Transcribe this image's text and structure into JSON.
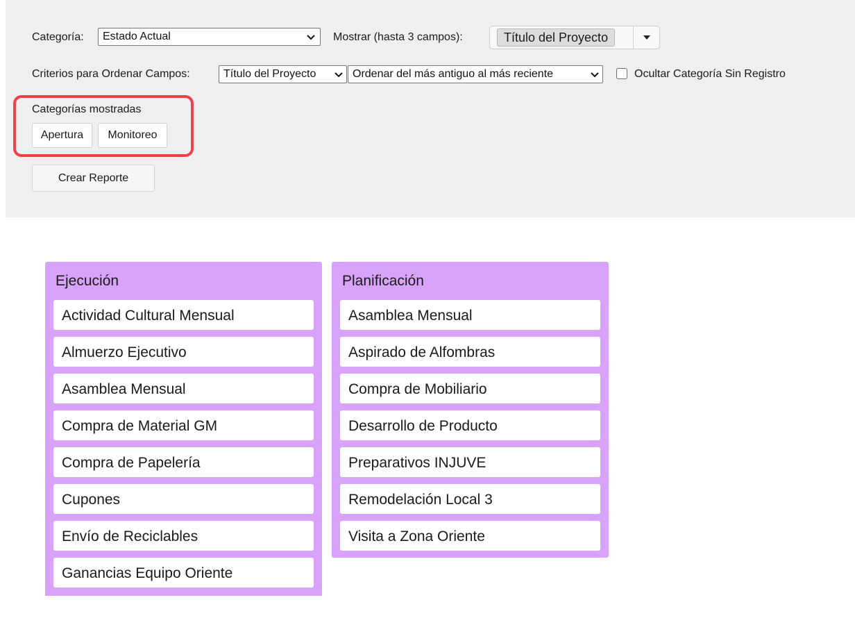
{
  "filters": {
    "category_label": "Categoría:",
    "category_value": "Estado Actual",
    "show_label": "Mostrar (hasta 3 campos):",
    "show_chip": "Título del Proyecto",
    "sort_label": "Criterios para Ordenar Campos:",
    "sort_field_value": "Título del Proyecto",
    "sort_order_value": "Ordenar del más antiguo al más reciente",
    "hide_empty_label": "Ocultar Categoría Sin Registro",
    "hide_empty_checked": false
  },
  "shown_categories": {
    "label": "Categorías mostradas",
    "items": [
      "Apertura",
      "Monitoreo"
    ]
  },
  "create_report_label": "Crear Reporte",
  "columns": [
    {
      "title": "Ejecución",
      "cards": [
        "Actividad Cultural Mensual",
        "Almuerzo Ejecutivo",
        "Asamblea Mensual",
        "Compra de Material GM",
        "Compra de Papelería",
        "Cupones",
        "Envío de Reciclables",
        "Ganancias Equipo Oriente"
      ]
    },
    {
      "title": "Planificación",
      "cards": [
        "Asamblea Mensual",
        "Aspirado de Alfombras",
        "Compra de Mobiliario",
        "Desarrollo de Producto",
        "Preparativos INJUVE",
        "Remodelación Local 3",
        "Visita a Zona Oriente"
      ]
    }
  ],
  "colors": {
    "panel_bg": "#efefef",
    "column_bg": "#d9a3fb",
    "highlight": "#ef4147"
  }
}
